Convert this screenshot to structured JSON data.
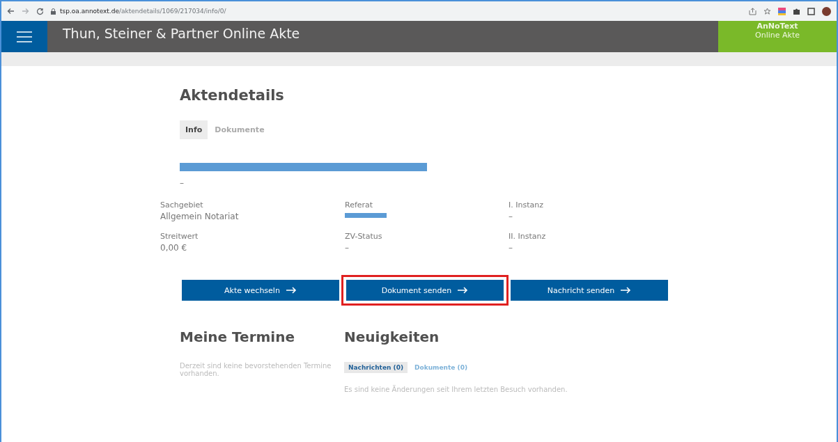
{
  "browser": {
    "url_host": "tsp.oa.annotext.de",
    "url_path": "/aktendetails/1069/217034/info/0/"
  },
  "header": {
    "title": "Thun, Steiner & Partner Online Akte",
    "brand": "AnNoText",
    "brand_sub": "Online Akte"
  },
  "page": {
    "title": "Aktendetails",
    "tabs": [
      {
        "label": "Info",
        "selected": true
      },
      {
        "label": "Dokumente",
        "selected": false
      }
    ],
    "subtitle": "–",
    "fields": [
      {
        "label": "Sachgebiet",
        "value": "Allgemein Notariat",
        "redacted": false
      },
      {
        "label": "Referat",
        "redacted": true
      },
      {
        "label": "I. Instanz",
        "value": "–",
        "redacted": false
      },
      {
        "label": "Streitwert",
        "value": "0,00 €",
        "redacted": false
      },
      {
        "label": "ZV-Status",
        "value": "–",
        "redacted": false
      },
      {
        "label": "II. Instanz",
        "value": "–",
        "redacted": false
      }
    ],
    "buttons": [
      {
        "label": "Akte wechseln",
        "highlighted": false
      },
      {
        "label": "Dokument senden",
        "highlighted": true
      },
      {
        "label": "Nachricht senden",
        "highlighted": false
      }
    ]
  },
  "termine": {
    "title": "Meine Termine",
    "empty_text": "Derzeit sind keine bevorstehenden Termine vorhanden."
  },
  "news": {
    "title": "Neuigkeiten",
    "tabs": [
      {
        "label": "Nachrichten (0)",
        "selected": true
      },
      {
        "label": "Dokumente (0)",
        "selected": false
      }
    ],
    "empty_text": "Es sind keine Änderungen seit Ihrem letzten Besuch vorhanden."
  }
}
